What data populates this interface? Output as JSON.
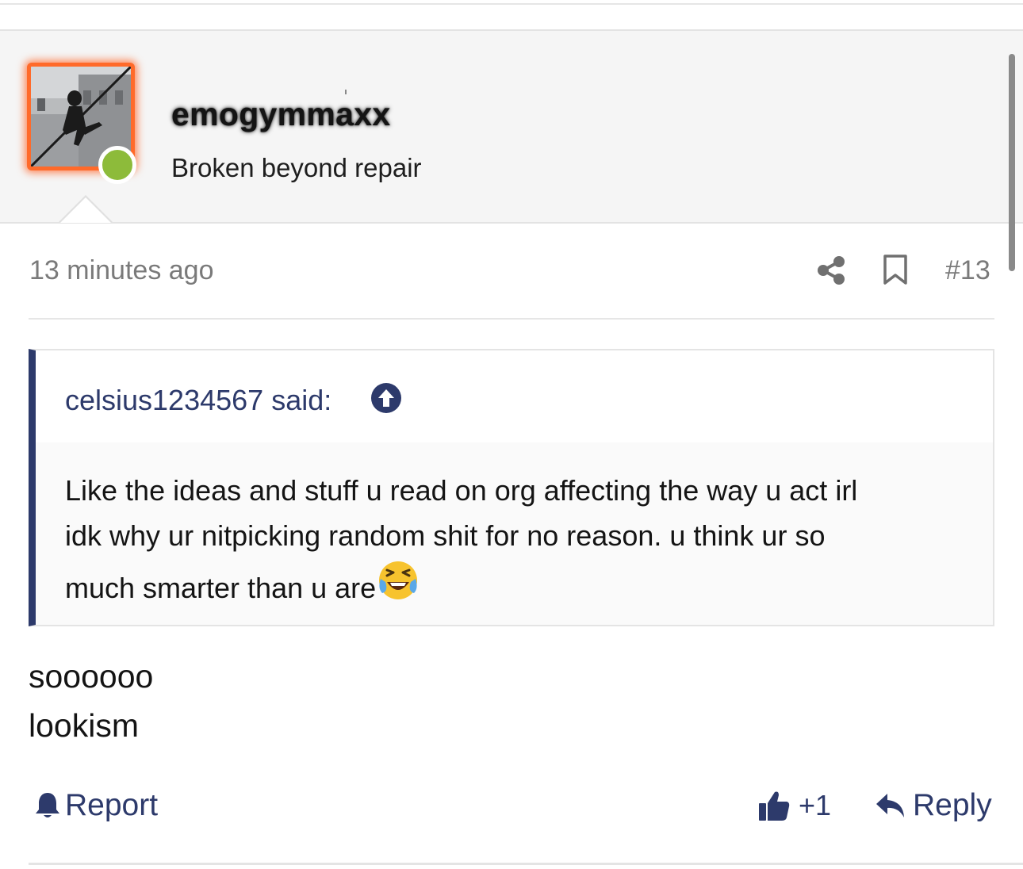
{
  "author": {
    "username": "emogymmaxx",
    "title": "Broken beyond repair",
    "status": "online",
    "avatar_border_color": "#ff6a2a",
    "online_color": "#8dbb3a"
  },
  "meta": {
    "time": "13 minutes ago",
    "post_number": "#13",
    "icons": [
      "share-icon",
      "bookmark-icon"
    ]
  },
  "quote": {
    "author_line": "celsius1234567 said:",
    "icon": "arrow-up-circle-icon",
    "lines": [
      "Like the ideas and stuff u read on org affecting the way u act irl",
      "idk why ur nitpicking random shit for no reason. u think ur so",
      "much smarter than u are"
    ],
    "emoji": "face-with-tears-of-joy-icon"
  },
  "post": {
    "lines": [
      "soooooo",
      "lookism"
    ]
  },
  "actions": {
    "report": "Report",
    "like_count": "+1",
    "reply": "Reply"
  },
  "colors": {
    "accent": "#2d3a6b",
    "muted": "#7a7a7a"
  }
}
